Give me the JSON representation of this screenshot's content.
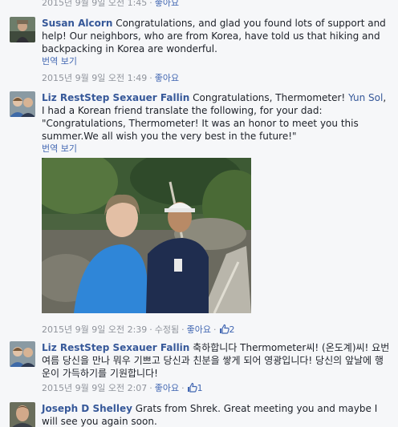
{
  "top_meta": {
    "timestamp": "2015년 9월 9일 오전 1:45",
    "like": "좋아요"
  },
  "comments": [
    {
      "author": "Susan Alcorn",
      "text": "Congratulations, and glad you found lots of support and help! Our neighbors, who are from Korea, have told us that hiking and backpacking in Korea are wonderful.",
      "translate": "번역 보기",
      "timestamp": "2015년 9월 9일 오전 1:49",
      "like": "좋아요"
    },
    {
      "author": "Liz RestStep Sexauer Fallin",
      "text_before": "Congratulations, Thermometer! ",
      "mention": "Yun Sol",
      "text_after": ", I had a Korean friend translate the following, for your dad: \"Congratulations, Thermometer! It was an honor to meet you this summer.We all wish you the very best in the future!\"",
      "translate": "번역 보기",
      "timestamp": "2015년 9월 9일 오전 2:39",
      "edited": "수정됨",
      "like": "좋아요",
      "like_count": "2"
    },
    {
      "author": "Liz RestStep Sexauer Fallin",
      "text": "축하합니다 Thermometer씨! (온도계)씨! 요번 여름 당신을 만나 뭐우 기쁘고 당신과 친분을 쌓게 되어 영광입니다! 당신의 앞날에 행운이 가득하기를 기원합니다!",
      "timestamp": "2015년 9월 9일 오전 2:07",
      "like": "좋아요",
      "like_count": "1"
    },
    {
      "author": "Joseph D Shelley",
      "text": "Grats from Shrek. Great meeting you and maybe I will see you again soon."
    }
  ],
  "colors": {
    "link": "#365899",
    "meta": "#90949c",
    "background": "#f6f7f9"
  },
  "icons": [
    "thumbs-up-icon"
  ]
}
